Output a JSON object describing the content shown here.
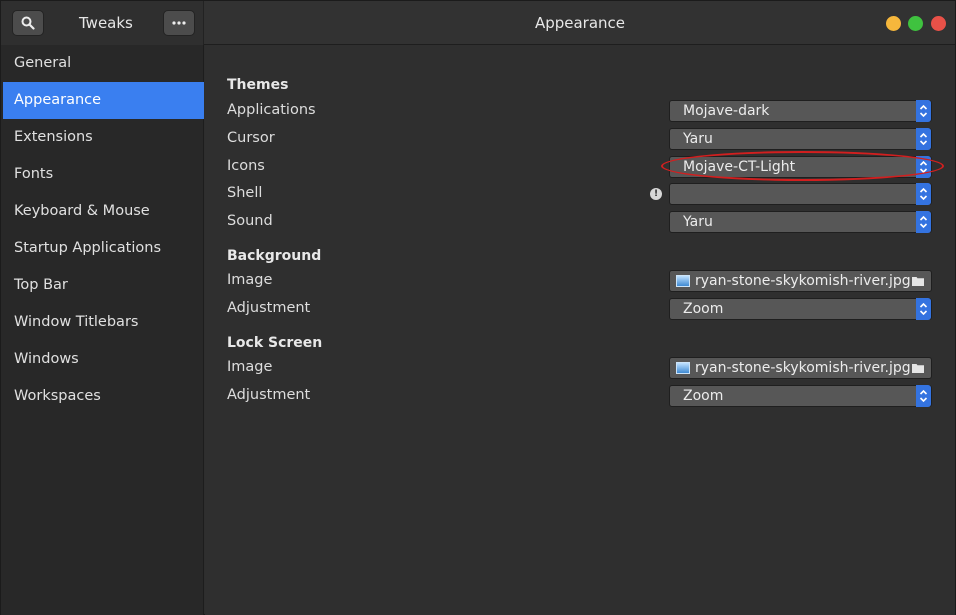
{
  "header": {
    "app_title": "Tweaks",
    "page_title": "Appearance"
  },
  "sidebar": {
    "items": [
      {
        "label": "General"
      },
      {
        "label": "Appearance"
      },
      {
        "label": "Extensions"
      },
      {
        "label": "Fonts"
      },
      {
        "label": "Keyboard & Mouse"
      },
      {
        "label": "Startup Applications"
      },
      {
        "label": "Top Bar"
      },
      {
        "label": "Window Titlebars"
      },
      {
        "label": "Windows"
      },
      {
        "label": "Workspaces"
      }
    ],
    "selected": "Appearance"
  },
  "themes": {
    "heading": "Themes",
    "applications": {
      "label": "Applications",
      "value": "Mojave-dark"
    },
    "cursor": {
      "label": "Cursor",
      "value": "Yaru"
    },
    "icons": {
      "label": "Icons",
      "value": "Mojave-CT-Light"
    },
    "shell": {
      "label": "Shell",
      "value": ""
    },
    "sound": {
      "label": "Sound",
      "value": "Yaru"
    }
  },
  "background": {
    "heading": "Background",
    "image": {
      "label": "Image",
      "value": "ryan-stone-skykomish-river.jpg"
    },
    "adjustment": {
      "label": "Adjustment",
      "value": "Zoom"
    }
  },
  "lock_screen": {
    "heading": "Lock Screen",
    "image": {
      "label": "Image",
      "value": "ryan-stone-skykomish-river.jpg"
    },
    "adjustment": {
      "label": "Adjustment",
      "value": "Zoom"
    }
  },
  "icons": {
    "search": "search-icon",
    "menu": "more-icon",
    "warning": "warning-icon",
    "folder": "folder-icon",
    "spin": "up-down-icon"
  },
  "colors": {
    "accent": "#3a7ff0",
    "highlight_ring": "#d21f1f",
    "minimize": "#f6b73c",
    "maximize": "#3fc23f",
    "close": "#e95148"
  }
}
